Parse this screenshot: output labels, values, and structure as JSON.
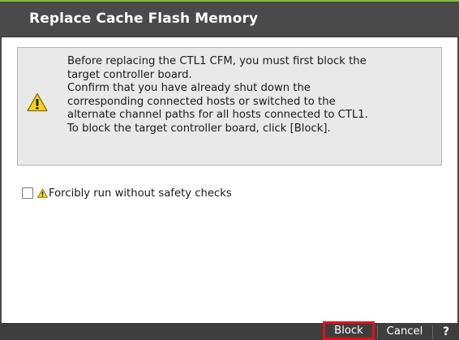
{
  "dialog": {
    "title": "Replace Cache Flash Memory",
    "accent_color": "#7ec13a",
    "titlebar_color": "#4a4a4a"
  },
  "message": {
    "icon": "warning-icon",
    "lines": [
      "Before replacing the CTL1 CFM, you must first block the",
      "target controller board.",
      "Confirm that you have already shut down the",
      "corresponding connected hosts or switched to the",
      "alternate channel paths for all hosts connected to CTL1.",
      "To block the target controller board, click [Block]."
    ]
  },
  "option": {
    "checked": false,
    "icon": "warning-icon",
    "label": "Forcibly run without safety checks"
  },
  "footer": {
    "block_label": "Block",
    "cancel_label": "Cancel",
    "help_label": "?",
    "highlight_color": "#e3101a"
  }
}
